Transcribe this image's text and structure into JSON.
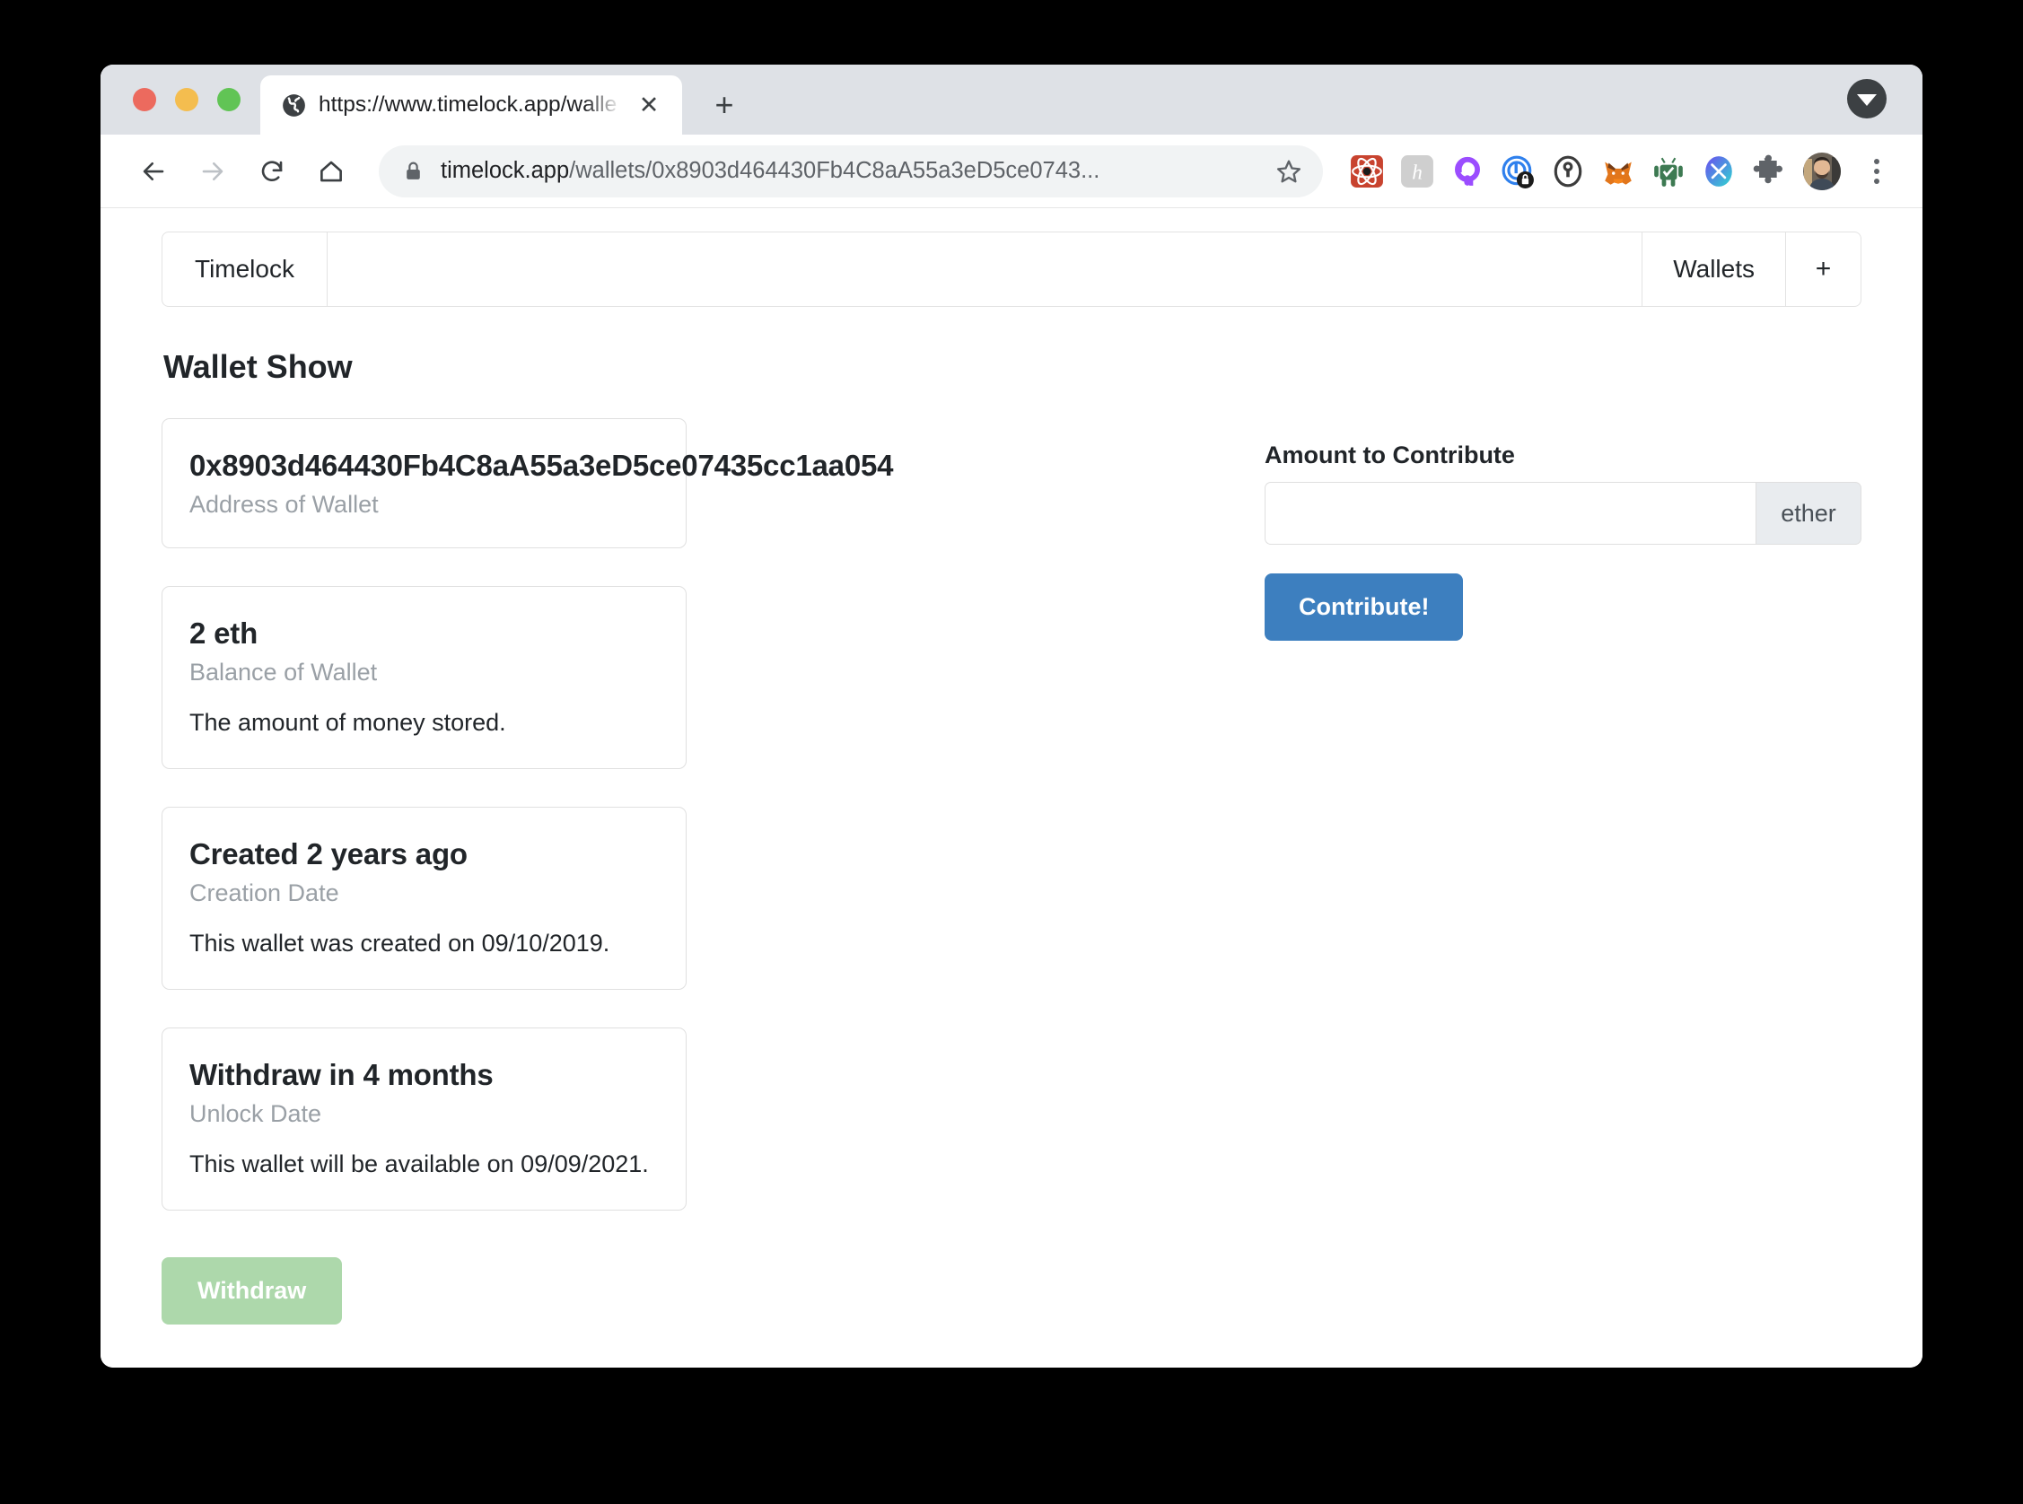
{
  "browser": {
    "tab": {
      "title": "https://www.timelock.app/walle",
      "favicon_icon": "globe-icon",
      "close_icon": "close-icon"
    },
    "new_tab_icon": "plus-icon",
    "tabstrip_caret_icon": "chevron-down-icon",
    "nav": {
      "back_icon": "back-arrow-icon",
      "forward_icon": "forward-arrow-icon",
      "reload_icon": "reload-icon",
      "home_icon": "home-icon"
    },
    "omnibox": {
      "lock_icon": "lock-icon",
      "url_host": "timelock.app",
      "url_path": "/wallets/0x8903d464430Fb4C8aA55a3eD5ce0743...",
      "star_icon": "star-icon"
    },
    "extensions": [
      {
        "name": "react-devtools-icon"
      },
      {
        "name": "honey-icon"
      },
      {
        "name": "octotree-icon"
      },
      {
        "name": "lock-shield-icon"
      },
      {
        "name": "onepassword-icon"
      },
      {
        "name": "metamask-fox-icon"
      },
      {
        "name": "android-robot-icon"
      },
      {
        "name": "tools-icon"
      },
      {
        "name": "puzzle-piece-icon"
      }
    ],
    "avatar_icon": "avatar",
    "menu_icon": "kebab-menu-icon"
  },
  "app": {
    "navbar": {
      "brand": "Timelock",
      "links": [
        "Wallets"
      ],
      "plus": "+"
    },
    "page_title": "Wallet Show",
    "cards": [
      {
        "title": "0x8903d464430Fb4C8aA55a3eD5ce07435cc1aa054",
        "subtitle": "Address of Wallet",
        "text": ""
      },
      {
        "title": "2 eth",
        "subtitle": "Balance of Wallet",
        "text": "The amount of money stored."
      },
      {
        "title": "Created 2 years ago",
        "subtitle": "Creation Date",
        "text": "This wallet was created on 09/10/2019."
      },
      {
        "title": "Withdraw in 4 months",
        "subtitle": "Unlock Date",
        "text": "This wallet will be available on 09/09/2021."
      }
    ],
    "withdraw_button": "Withdraw",
    "contribute": {
      "label": "Amount to Contribute",
      "input_value": "",
      "input_placeholder": "",
      "addon": "ether",
      "button": "Contribute!"
    }
  },
  "colors": {
    "accent_blue": "#3d7fbf",
    "withdraw_green": "#add8ab",
    "tabstrip_gray": "#dee1e6",
    "omnibox_gray": "#f1f3f4",
    "muted_text": "#9aa0a6"
  }
}
